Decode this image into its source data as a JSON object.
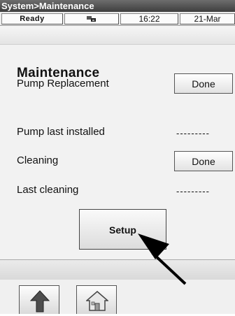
{
  "window": {
    "title": "System>Maintenance"
  },
  "status": {
    "state": "Ready",
    "icon": "network-icon",
    "time": "16:22",
    "date": "21-Mar"
  },
  "main": {
    "heading": "Maintenance",
    "rows": [
      {
        "label": "Pump Replacement",
        "button": "Done"
      },
      {
        "label": "Pump last installed",
        "value": "---------"
      },
      {
        "label": "Cleaning",
        "button": "Done"
      },
      {
        "label": "Last cleaning",
        "value": "---------"
      }
    ],
    "setup_label": "Setup"
  },
  "footer": {
    "buttons": [
      {
        "icon": "up-arrow-icon"
      },
      {
        "icon": "home-icon"
      }
    ]
  },
  "colors": {
    "titlebar": "#4a4a4a",
    "background": "#f2f2f2"
  }
}
